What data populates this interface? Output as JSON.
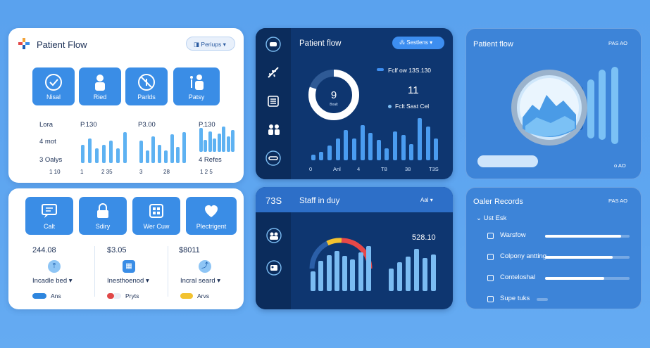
{
  "card1": {
    "title": "Patient Flow",
    "dropdown": "Periups",
    "tiles": [
      "Nisal",
      "Ried",
      "Parlds",
      "Patsy"
    ],
    "stats": {
      "row1": [
        "Lora",
        "P.130",
        "P3.00",
        "P.130"
      ],
      "row2": [
        "4 mot",
        "4 Refes"
      ],
      "row3": [
        "3 Oalys"
      ],
      "axis1": [
        "1 10",
        "1",
        "2 35"
      ],
      "axis2": [
        "3",
        "28",
        "1 2 5"
      ]
    },
    "series": [
      [
        18,
        24,
        14,
        18,
        22,
        14,
        30
      ],
      [
        22,
        12,
        26,
        18,
        12,
        28,
        16,
        30
      ],
      [
        28,
        14,
        24,
        16,
        22,
        30,
        18,
        26
      ]
    ]
  },
  "card2": {
    "tiles": [
      "Calt",
      "Sdiry",
      "Wer Cuw",
      "Plectrigent"
    ],
    "values": [
      "244.08",
      "$3.05",
      "$8011"
    ],
    "labels": [
      "Incadle bed",
      "Inesthoenod",
      "Incral seard"
    ],
    "legend": [
      "Ans",
      "Pryts",
      "Arvs"
    ],
    "legend_colors": [
      "#2e86de",
      "#e04848",
      "#f2c230"
    ]
  },
  "card3": {
    "title": "Patient flow",
    "dropdown": "Sestlens",
    "donut_value": "9",
    "donut_sub": "Boalt",
    "donut_fraction": 0.8,
    "legend1": "Fclf ow 13S.130",
    "big_value": "11",
    "legend2": "Fclt Sast Cel",
    "axis": [
      "0",
      "Anl",
      "4",
      "T8",
      "38",
      "T3S"
    ],
    "bars": [
      8,
      12,
      20,
      30,
      42,
      30,
      48,
      38,
      28,
      16,
      40,
      35,
      22,
      58,
      46,
      30
    ]
  },
  "card4": {
    "title": "Patient flow",
    "corner": "PAS AO",
    "footer": "o AO"
  },
  "card5": {
    "value": "73S",
    "title": "Staff in duy",
    "dropdown": "Aal",
    "gauge_value": "528.10",
    "bars": [
      40,
      60,
      72,
      80,
      70,
      64,
      78,
      90
    ],
    "bars2": [
      48,
      62,
      74,
      90,
      70,
      78
    ]
  },
  "card6": {
    "title": "Oaler Records",
    "corner": "PAS AO",
    "group": "Ust Esk",
    "items": [
      {
        "label": "Warsfow",
        "progress": 0.9
      },
      {
        "label": "Colpony antting",
        "progress": 0.8
      },
      {
        "label": "Conteloshal",
        "progress": 0.7
      },
      {
        "label": "Supe tuks",
        "progress": 0.0
      }
    ]
  }
}
